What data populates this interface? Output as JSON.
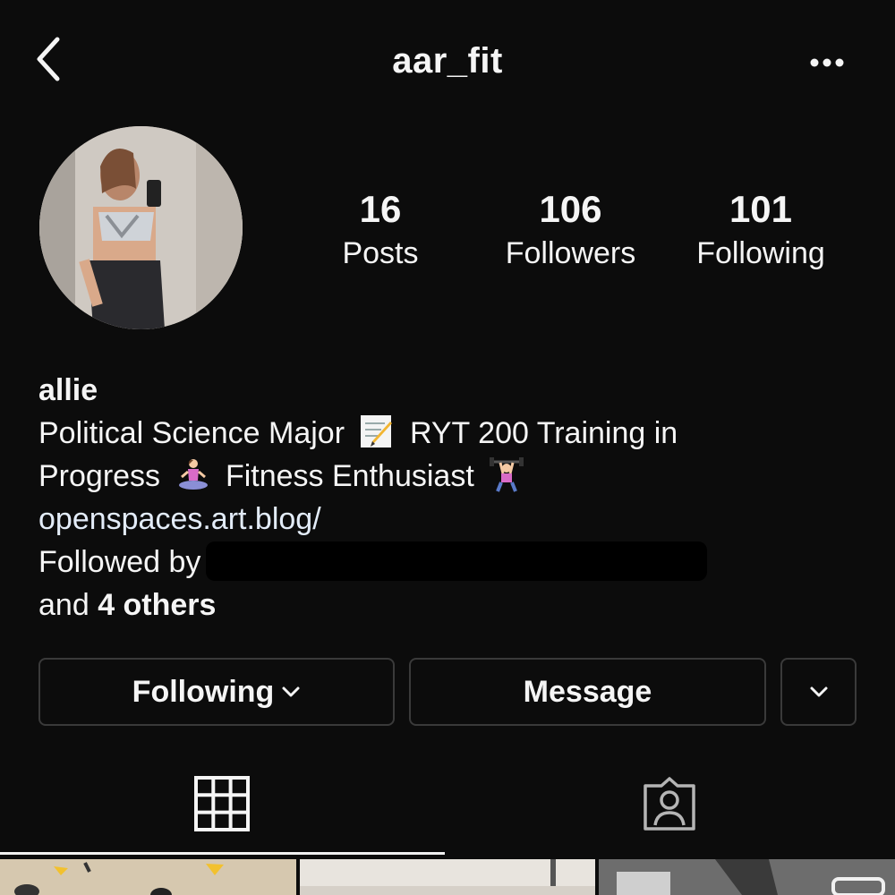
{
  "header": {
    "username": "aar_fit",
    "back_icon": "chevron-left-icon",
    "more_icon": "more-horizontal-icon"
  },
  "stats": {
    "posts": {
      "count": "16",
      "label": "Posts"
    },
    "followers": {
      "count": "106",
      "label": "Followers"
    },
    "following": {
      "count": "101",
      "label": "Following"
    }
  },
  "bio": {
    "name": "allie",
    "line1_a": "Political Science Major",
    "line1_b": "RYT 200 Training in",
    "line2_a": "Progress",
    "line2_b": "Fitness Enthusiast",
    "link": "openspaces.art.blog/",
    "followed_by": "Followed by",
    "and_text": "and",
    "others": "4 others",
    "emojis": [
      "memo-emoji",
      "person-in-lotus-position-emoji",
      "person-lifting-weights-emoji"
    ]
  },
  "actions": {
    "following_label": "Following",
    "message_label": "Message"
  },
  "tabs": {
    "grid_icon": "grid-icon",
    "tagged_icon": "tagged-person-icon"
  },
  "colors": {
    "background": "#0c0c0c",
    "text": "#f5f5f5",
    "button_border": "#3a3a3a"
  }
}
